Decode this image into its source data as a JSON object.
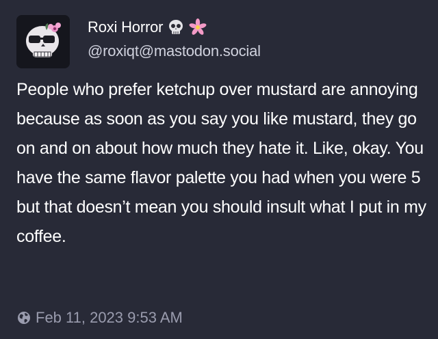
{
  "post": {
    "author": {
      "display_name": "Roxi Horror",
      "handle": "@roxiqt@mastodon.social",
      "name_emojis": [
        "skull-emoji",
        "pink-flower-emoji"
      ]
    },
    "content": "People who prefer ketchup over mustard are annoying because as soon as you say you like mustard, they go on and on about how much they hate it. Like, okay. You have the same flavor palette you had when you were 5 but that doesn’t mean you should insult what I put in my coffee.",
    "visibility_icon": "globe-icon",
    "timestamp": "Feb 11, 2023 9:53 AM"
  },
  "colors": {
    "background": "#282a37",
    "text": "#ffffff",
    "secondary_text": "#9a9cae",
    "avatar_accent": "#e88fc4"
  }
}
